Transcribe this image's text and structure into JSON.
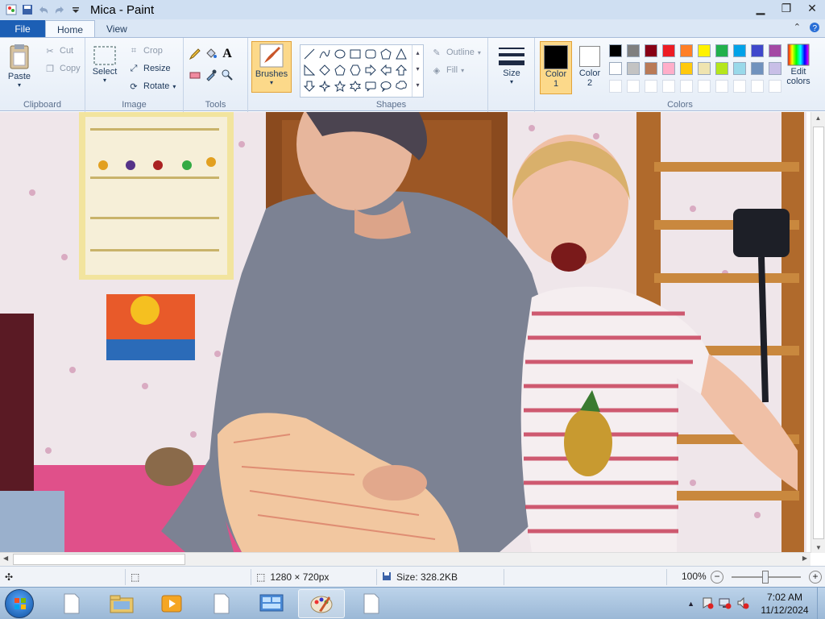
{
  "window": {
    "title": "Mica - Paint"
  },
  "tabs": {
    "file": "File",
    "home": "Home",
    "view": "View"
  },
  "clipboard": {
    "paste": "Paste",
    "cut": "Cut",
    "copy": "Copy",
    "group": "Clipboard"
  },
  "image": {
    "select": "Select",
    "crop": "Crop",
    "resize": "Resize",
    "rotate": "Rotate",
    "group": "Image"
  },
  "tools": {
    "group": "Tools"
  },
  "brushes": {
    "label": "Brushes"
  },
  "shapes": {
    "outline": "Outline",
    "fill": "Fill",
    "group": "Shapes"
  },
  "size": {
    "label": "Size"
  },
  "colors": {
    "color1_label": "Color",
    "color1_num": "1",
    "color2_label": "Color",
    "color2_num": "2",
    "edit_label": "Edit",
    "edit_label2": "colors",
    "group": "Colors",
    "color1_value": "#000000",
    "color2_value": "#ffffff",
    "palette": [
      "#000000",
      "#7f7f7f",
      "#880015",
      "#ed1c24",
      "#ff7f27",
      "#fff200",
      "#22b14c",
      "#00a2e8",
      "#3f48cc",
      "#a349a4",
      "#ffffff",
      "#c3c3c3",
      "#b97a57",
      "#ffaec9",
      "#ffc90e",
      "#efe4b0",
      "#b5e61d",
      "#99d9ea",
      "#7092be",
      "#c8bfe7"
    ]
  },
  "status": {
    "dimensions": "1280 × 720px",
    "size": "Size: 328.2KB",
    "zoom": "100%"
  },
  "taskbar": {
    "time": "7:02 AM",
    "date": "11/12/2024"
  }
}
